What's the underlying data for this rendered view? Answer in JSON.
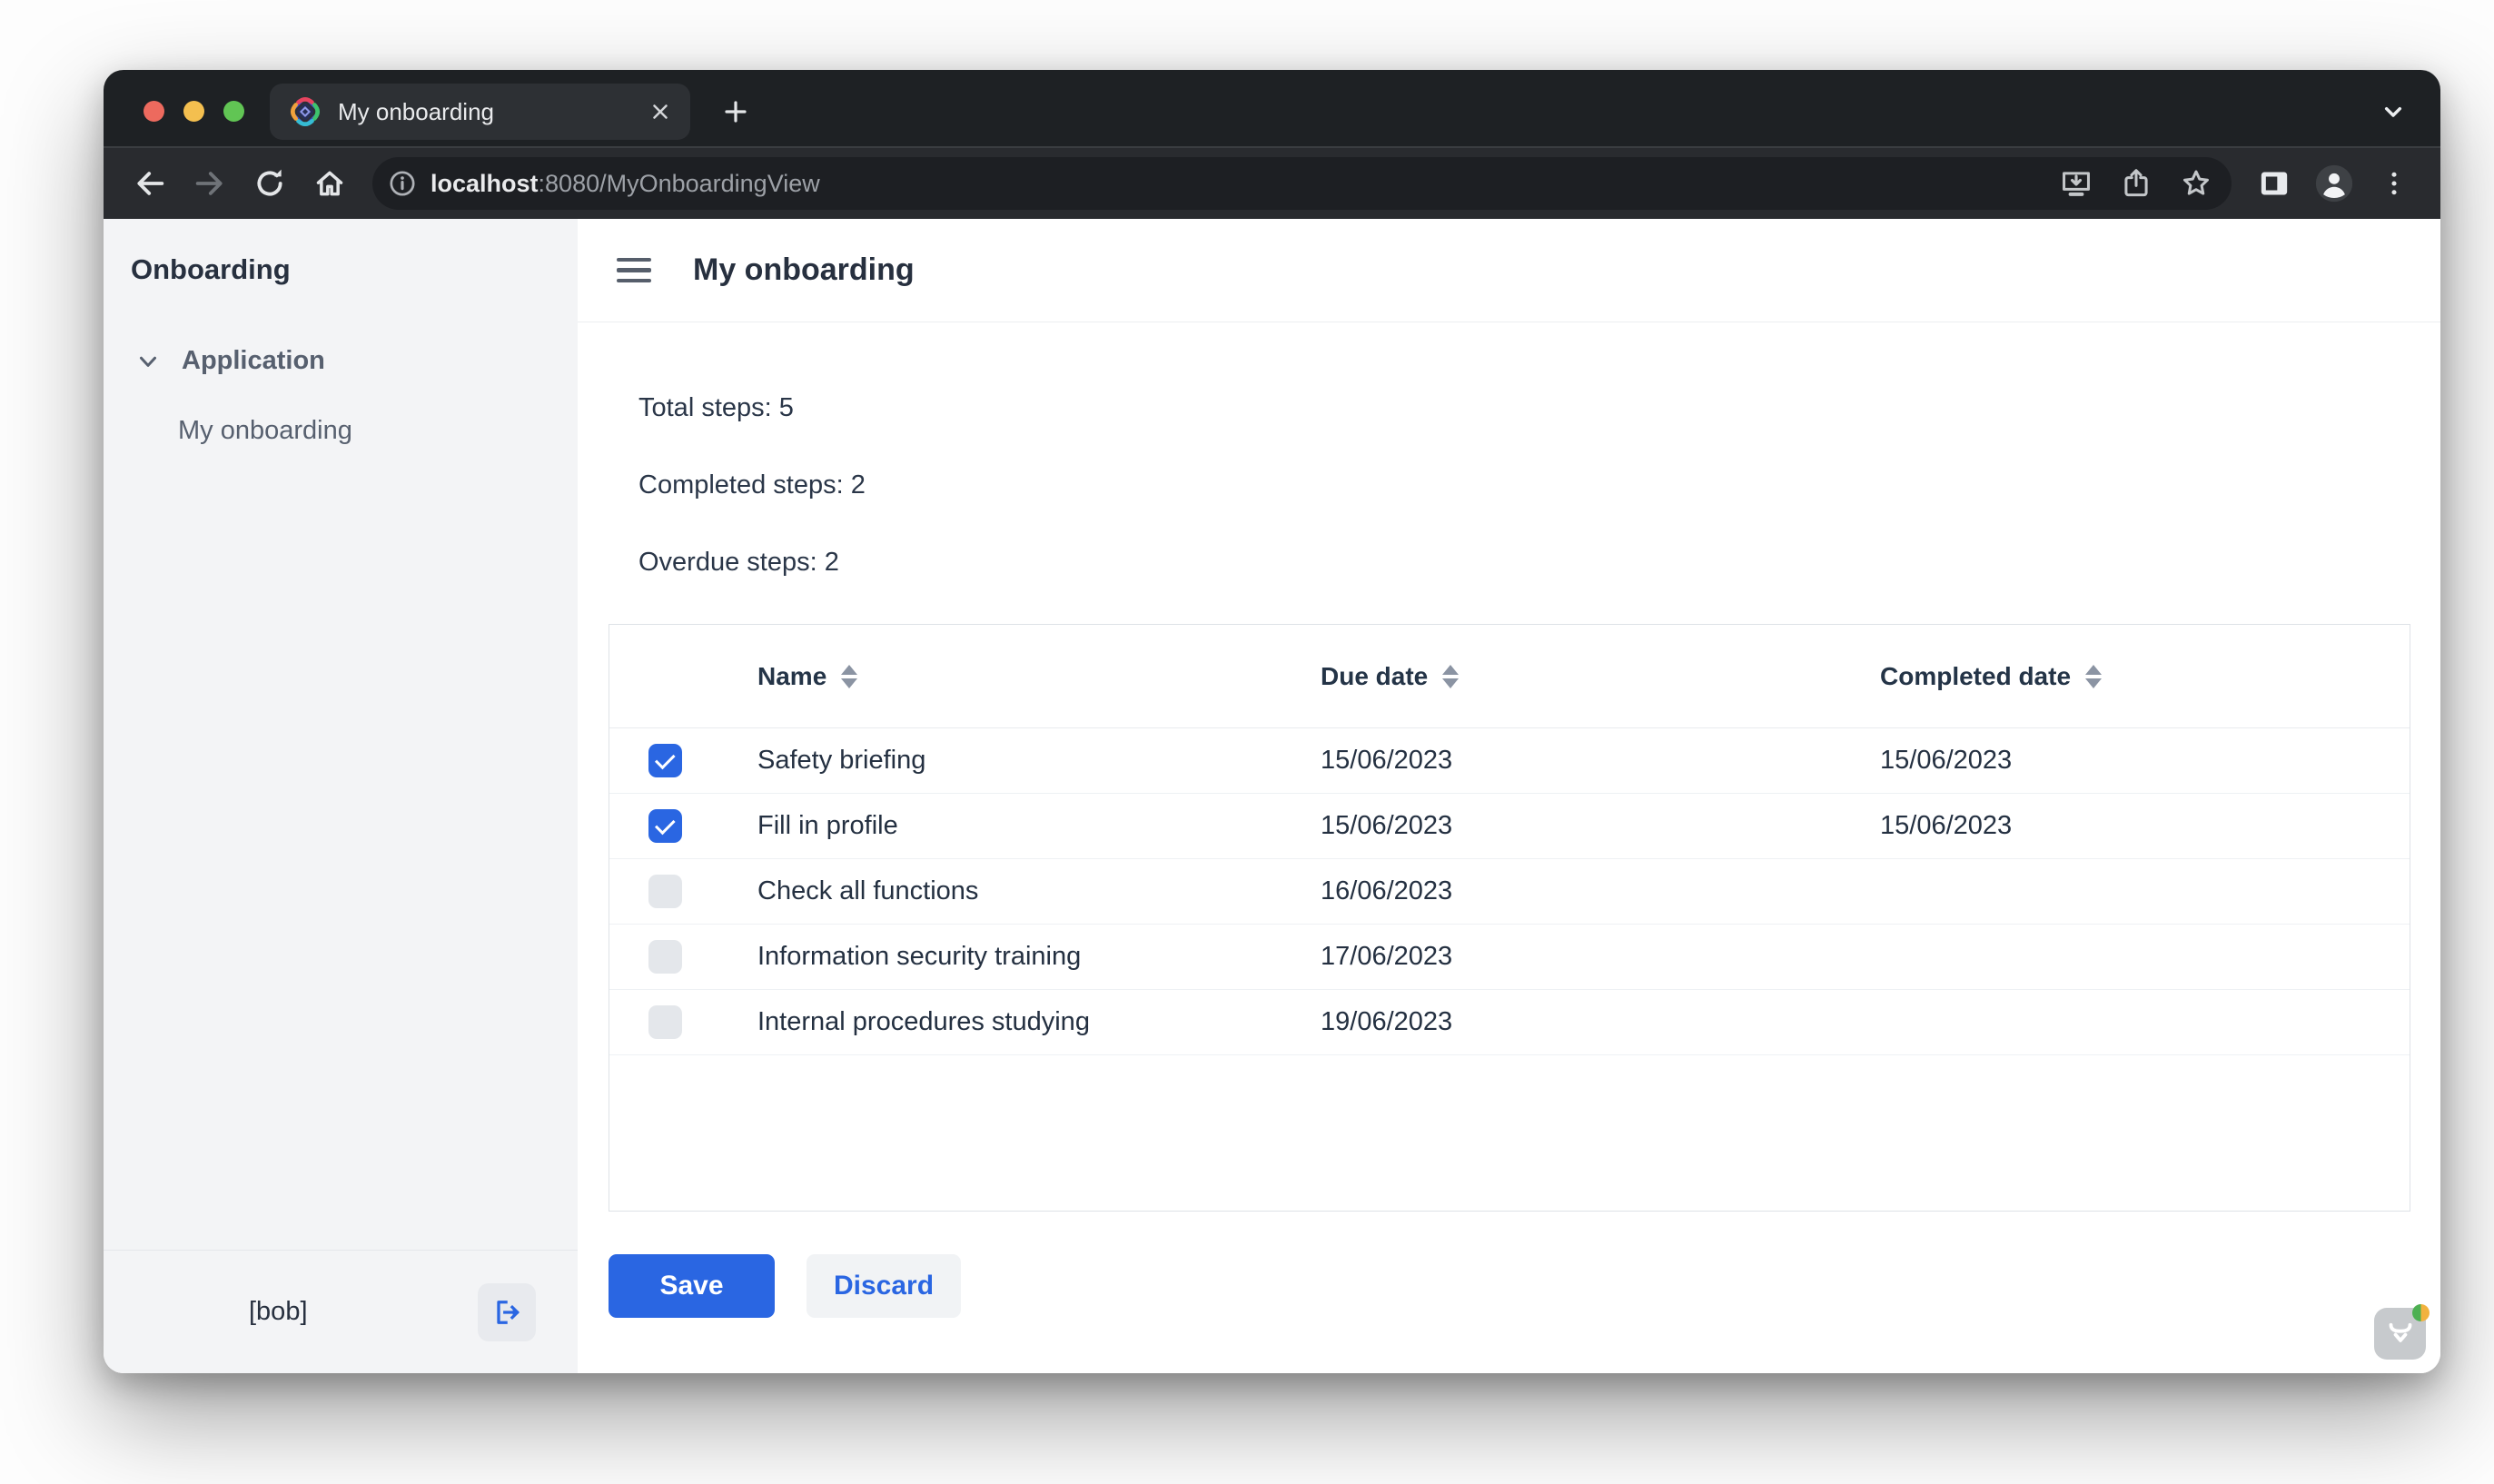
{
  "browser": {
    "window_controls": {
      "close": "red",
      "minimize": "yellow",
      "maximize": "green"
    },
    "tab": {
      "title": "My onboarding",
      "favicon": "vaadin-diamond-icon",
      "close_icon": "close-icon"
    },
    "new_tab_icon": "plus-icon",
    "tab_overflow_icon": "chevron-down-icon",
    "toolbar_icons": [
      "back-arrow-icon",
      "forward-arrow-icon",
      "reload-icon",
      "home-icon",
      "install-app-icon",
      "share-icon",
      "bookmark-star-icon",
      "side-panel-icon",
      "profile-avatar-icon",
      "kebab-menu-icon"
    ],
    "url": {
      "info_icon": "info-icon",
      "host": "localhost",
      "path": ":8080/MyOnboardingView"
    }
  },
  "sidebar": {
    "app_title": "Onboarding",
    "section_label": "Application",
    "section_chevron_icon": "chevron-down-icon",
    "items": [
      {
        "label": "My onboarding"
      }
    ],
    "footer": {
      "user": "[bob]",
      "logout_icon": "sign-out-icon"
    }
  },
  "page": {
    "title": "My onboarding",
    "menu_icon": "hamburger-icon",
    "stats": {
      "total": "Total steps: 5",
      "completed": "Completed steps: 2",
      "overdue": "Overdue steps: 2"
    }
  },
  "table": {
    "columns": [
      {
        "label": "Name"
      },
      {
        "label": "Due date"
      },
      {
        "label": "Completed date"
      }
    ],
    "sort_icon": "sort-arrows-icon",
    "rows": [
      {
        "checked": true,
        "name": "Safety briefing",
        "due": "15/06/2023",
        "completed": "15/06/2023"
      },
      {
        "checked": true,
        "name": "Fill in profile",
        "due": "15/06/2023",
        "completed": "15/06/2023"
      },
      {
        "checked": false,
        "name": "Check all functions",
        "due": "16/06/2023",
        "completed": ""
      },
      {
        "checked": false,
        "name": "Information security training",
        "due": "17/06/2023",
        "completed": ""
      },
      {
        "checked": false,
        "name": "Internal procedures studying",
        "due": "19/06/2023",
        "completed": ""
      }
    ]
  },
  "actions": {
    "save": "Save",
    "discard": "Discard"
  },
  "dev_tools": {
    "icon": "vaadin-logo-icon",
    "status_dot": "green-orange"
  },
  "colors": {
    "primary_blue": "#2a66e2",
    "checkbox_unchecked": "#e4e7eb",
    "sidebar_bg": "#f3f4f6",
    "chrome_tabstrip": "#1e2124",
    "chrome_toolbar": "#292b2f",
    "chrome_urlbar": "#1d1f23",
    "text_dark": "#243041",
    "text_secondary": "#57606f"
  }
}
